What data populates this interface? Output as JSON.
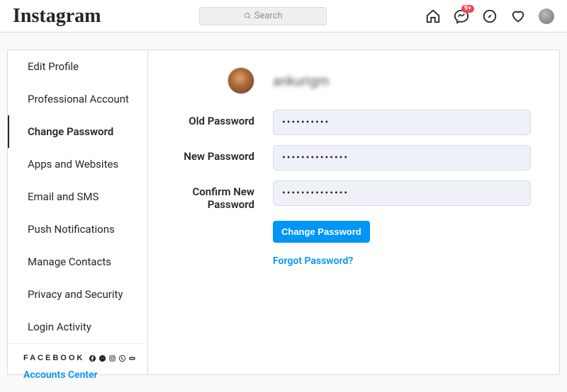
{
  "brand": "Instagram",
  "search": {
    "placeholder": "Search"
  },
  "notif_badge": "9+",
  "sidebar": {
    "items": [
      {
        "label": "Edit Profile",
        "active": false
      },
      {
        "label": "Professional Account",
        "active": false
      },
      {
        "label": "Change Password",
        "active": true
      },
      {
        "label": "Apps and Websites",
        "active": false
      },
      {
        "label": "Email and SMS",
        "active": false
      },
      {
        "label": "Push Notifications",
        "active": false
      },
      {
        "label": "Manage Contacts",
        "active": false
      },
      {
        "label": "Privacy and Security",
        "active": false
      },
      {
        "label": "Login Activity",
        "active": false
      }
    ],
    "footer_brand": "FACEBOOK",
    "accounts_center": "Accounts Center"
  },
  "profile": {
    "username": "ankurigm"
  },
  "form": {
    "old_label": "Old Password",
    "old_value": "••••••••••",
    "new_label": "New Password",
    "new_value": "••••••••••••••",
    "confirm_label": "Confirm New Password",
    "confirm_value": "••••••••••••••",
    "submit": "Change Password",
    "forgot": "Forgot Password?"
  }
}
